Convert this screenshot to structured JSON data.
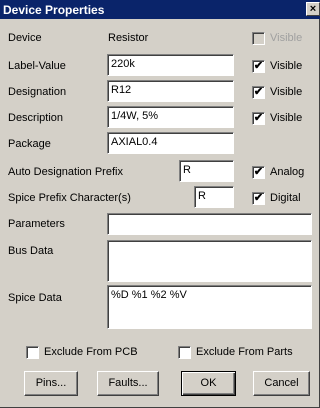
{
  "window": {
    "title": "Device Properties",
    "close_glyph": "×"
  },
  "device": {
    "label": "Device",
    "value": "Resistor",
    "visible_label": "Visible"
  },
  "label_value": {
    "label": "Label-Value",
    "value": "220k",
    "visible_label": "Visible",
    "visible_checked": "✔"
  },
  "designation": {
    "label": "Designation",
    "value": "R12",
    "visible_label": "Visible",
    "visible_checked": "✔"
  },
  "description": {
    "label": "Description",
    "value": "1/4W, 5%",
    "visible_label": "Visible",
    "visible_checked": "✔"
  },
  "package": {
    "label": "Package",
    "value": "AXIAL0.4"
  },
  "auto_designation": {
    "label": "Auto Designation Prefix",
    "value": "R",
    "check_label": "Analog",
    "check_mark": "✔"
  },
  "spice_prefix": {
    "label": "Spice Prefix Character(s)",
    "value": "R",
    "check_label": "Digital",
    "check_mark": "✔"
  },
  "parameters": {
    "label": "Parameters",
    "value": ""
  },
  "bus_data": {
    "label": "Bus Data",
    "value": ""
  },
  "spice_data": {
    "label": "Spice Data",
    "value": "%D %1 %2 %V"
  },
  "exclude_pcb": {
    "label": "Exclude From PCB"
  },
  "exclude_parts": {
    "label": "Exclude From Parts"
  },
  "buttons": {
    "pins": "Pins...",
    "faults": "Faults...",
    "ok": "OK",
    "cancel": "Cancel"
  }
}
